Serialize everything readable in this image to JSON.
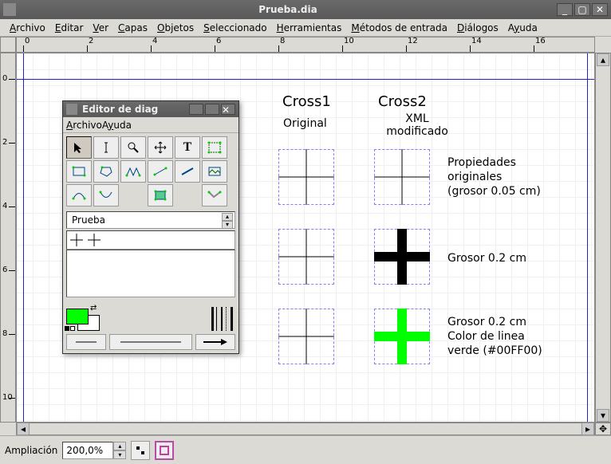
{
  "window": {
    "title": "Prueba.dia"
  },
  "menubar": [
    "Archivo",
    "Editar",
    "Ver",
    "Capas",
    "Objetos",
    "Seleccionado",
    "Herramientas",
    "Métodos de entrada",
    "Diálogos",
    "Ayuda"
  ],
  "ruler_h": [
    0,
    2,
    4,
    6,
    8,
    10,
    12,
    14,
    16
  ],
  "ruler_v": [
    0,
    2,
    4,
    6,
    8,
    10
  ],
  "diagram": {
    "col_headers": [
      "Cross1",
      "Cross2"
    ],
    "col_subheaders": [
      "Original",
      "XML modificado"
    ],
    "row_desc": [
      "Propiedades originales (grosor 0.05 cm)",
      "Grosor 0.2 cm",
      "Grosor 0.2 cm Color de linea verde (#00FF00)"
    ]
  },
  "editor": {
    "title": "Editor de diag",
    "menu": [
      "Archivo",
      "Ayuda"
    ],
    "tools": [
      "pointer",
      "text-cursor",
      "zoom",
      "move",
      "text",
      "select-box",
      "rect",
      "polygon",
      "zigzag",
      "line-seg",
      "line",
      "image-box",
      "curve-a",
      "curve-b",
      "poly-edit",
      "link"
    ],
    "section": "Prueba",
    "fg_color": "#00FF00",
    "bg_color": "#FFFFFF"
  },
  "status": {
    "zoom_label": "Ampliación",
    "zoom_value": "200,0%"
  }
}
